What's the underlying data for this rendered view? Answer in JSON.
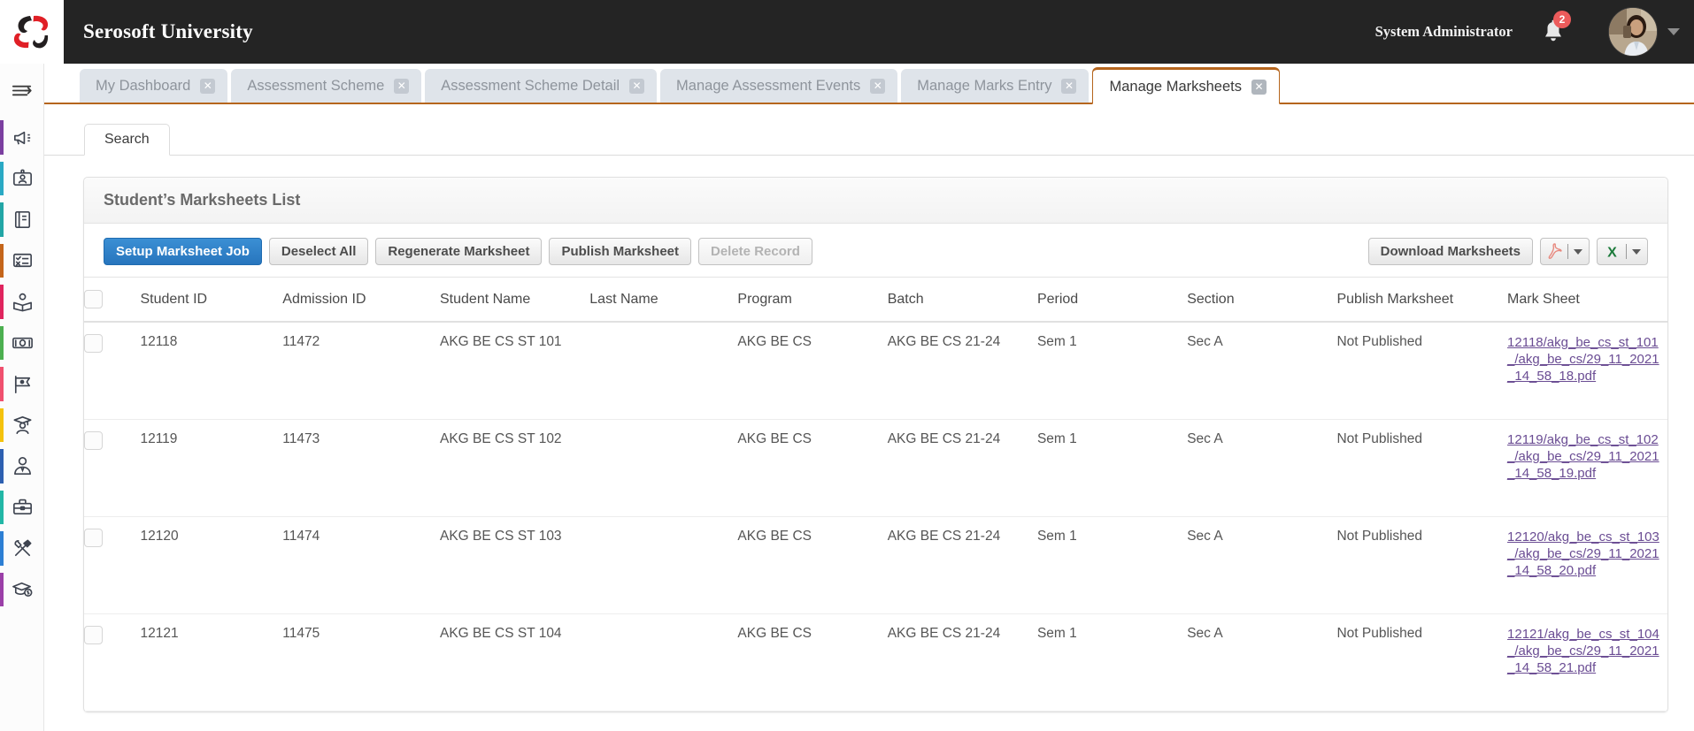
{
  "header": {
    "brand": "Serosoft University",
    "logo_icon": "serosoft-pinwheel-logo",
    "user_name": "System Administrator",
    "notification_icon": "bell-icon",
    "notification_count": "2",
    "avatar_icon": "user-avatar",
    "user_menu_icon": "chevron-down-icon"
  },
  "sidebar": {
    "toggle_icon": "hamburger-expand-icon",
    "items": [
      {
        "icon": "megaphone-icon",
        "accent": "#7b3fa0"
      },
      {
        "icon": "id-badge-icon",
        "accent": "#2aa9c4"
      },
      {
        "icon": "book-icon",
        "accent": "#22a6a6"
      },
      {
        "icon": "checklist-icon",
        "accent": "#c4651a"
      },
      {
        "icon": "reading-person-icon",
        "accent": "#e0245e"
      },
      {
        "icon": "banknote-icon",
        "accent": "#4caf50"
      },
      {
        "icon": "flag-icon",
        "accent": "#f0506e"
      },
      {
        "icon": "graduate-student-icon",
        "accent": "#f4c20d"
      },
      {
        "icon": "staff-person-icon",
        "accent": "#2d5fb0"
      },
      {
        "icon": "briefcase-icon",
        "accent": "#22b7a6"
      },
      {
        "icon": "tools-icon",
        "accent": "#2d7fd4"
      },
      {
        "icon": "scholarship-cap-icon",
        "accent": "#9b3fa8"
      }
    ]
  },
  "tabs": [
    {
      "label": "My Dashboard",
      "active": false,
      "close_icon": "close-icon"
    },
    {
      "label": "Assessment Scheme",
      "active": false,
      "close_icon": "close-icon"
    },
    {
      "label": "Assessment Scheme Detail",
      "active": false,
      "close_icon": "close-icon"
    },
    {
      "label": "Manage Assessment Events",
      "active": false,
      "close_icon": "close-icon"
    },
    {
      "label": "Manage Marks Entry",
      "active": false,
      "close_icon": "close-icon"
    },
    {
      "label": "Manage Marksheets",
      "active": true,
      "close_icon": "close-icon"
    }
  ],
  "subtab": {
    "label": "Search"
  },
  "panel": {
    "title": "Student’s Marksheets List"
  },
  "toolbar": {
    "setup_label": "Setup Marksheet Job",
    "deselect_label": "Deselect All",
    "regenerate_label": "Regenerate Marksheet",
    "publish_label": "Publish Marksheet",
    "delete_label": "Delete Record",
    "download_label": "Download Marksheets",
    "pdf_icon": "pdf-acrobat-icon",
    "excel_icon": "excel-icon",
    "dropdown_icon": "caret-down-icon",
    "primary_color": "#2775bd"
  },
  "table": {
    "select_all_icon": "checkbox-unchecked",
    "columns": [
      "Student ID",
      "Admission ID",
      "Student Name",
      "Last Name",
      "Program",
      "Batch",
      "Period",
      "Section",
      "Publish Marksheet",
      "Mark Sheet"
    ],
    "rows": [
      {
        "student_id": "12118",
        "admission_id": "11472",
        "student_name": "AKG BE CS ST 101",
        "last_name": "",
        "program": "AKG BE CS",
        "batch": "AKG BE CS 21-24",
        "period": "Sem 1",
        "section": "Sec A",
        "publish_marksheet": "Not Published",
        "mark_sheet": "12118/akg_be_cs_st_101_/akg_be_cs/29_11_2021_14_58_18.pdf"
      },
      {
        "student_id": "12119",
        "admission_id": "11473",
        "student_name": "AKG BE CS ST 102",
        "last_name": "",
        "program": "AKG BE CS",
        "batch": "AKG BE CS 21-24",
        "period": "Sem 1",
        "section": "Sec A",
        "publish_marksheet": "Not Published",
        "mark_sheet": "12119/akg_be_cs_st_102_/akg_be_cs/29_11_2021_14_58_19.pdf"
      },
      {
        "student_id": "12120",
        "admission_id": "11474",
        "student_name": "AKG BE CS ST 103",
        "last_name": "",
        "program": "AKG BE CS",
        "batch": "AKG BE CS 21-24",
        "period": "Sem 1",
        "section": "Sec A",
        "publish_marksheet": "Not Published",
        "mark_sheet": "12120/akg_be_cs_st_103_/akg_be_cs/29_11_2021_14_58_20.pdf"
      },
      {
        "student_id": "12121",
        "admission_id": "11475",
        "student_name": "AKG BE CS ST 104",
        "last_name": "",
        "program": "AKG BE CS",
        "batch": "AKG BE CS 21-24",
        "period": "Sem 1",
        "section": "Sec A",
        "publish_marksheet": "Not Published",
        "mark_sheet": "12121/akg_be_cs_st_104_/akg_be_cs/29_11_2021_14_58_21.pdf"
      }
    ]
  }
}
